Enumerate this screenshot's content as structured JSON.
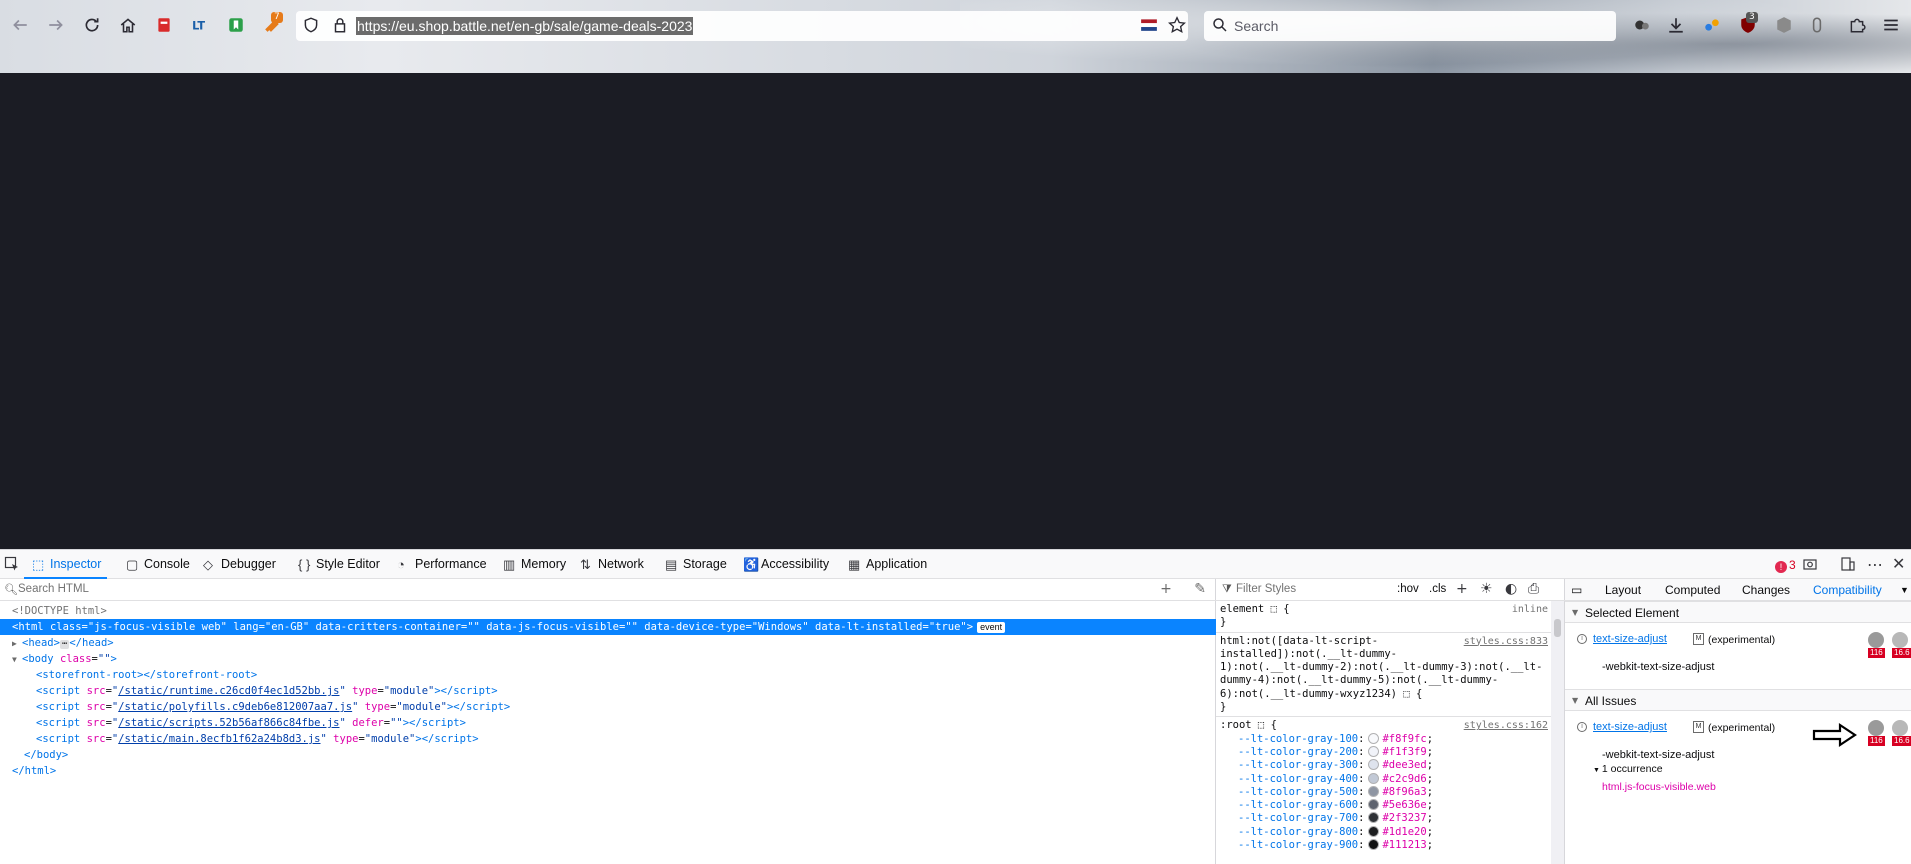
{
  "browser": {
    "url": "https://eu.shop.battle.net/en-gb/sale/game-deals-2023",
    "search_placeholder": "Search",
    "ext_badge_7": "7",
    "ext_badge_3": "3"
  },
  "devtools": {
    "tabs": [
      {
        "label": "Inspector",
        "icon": "inspector-icon"
      },
      {
        "label": "Console",
        "icon": "console-icon"
      },
      {
        "label": "Debugger",
        "icon": "debugger-icon"
      },
      {
        "label": "Style Editor",
        "icon": "style-editor-icon"
      },
      {
        "label": "Performance",
        "icon": "performance-icon"
      },
      {
        "label": "Memory",
        "icon": "memory-icon"
      },
      {
        "label": "Network",
        "icon": "network-icon"
      },
      {
        "label": "Storage",
        "icon": "storage-icon"
      },
      {
        "label": "Accessibility",
        "icon": "accessibility-icon"
      },
      {
        "label": "Application",
        "icon": "application-icon"
      }
    ],
    "error_count": "3",
    "markup": {
      "search_placeholder": "Search HTML",
      "doctype": "<!DOCTYPE html>",
      "html_open": {
        "tag": "html",
        "attrs": [
          {
            "name": "class",
            "value": "js-focus-visible web"
          },
          {
            "name": "lang",
            "value": "en-GB"
          },
          {
            "name": "data-critters-container",
            "value": ""
          },
          {
            "name": "data-js-focus-visible",
            "value": ""
          },
          {
            "name": "data-device-type",
            "value": "Windows"
          },
          {
            "name": "data-lt-installed",
            "value": "true"
          }
        ],
        "event_badge": "event"
      },
      "head_line": {
        "open": "<head>",
        "close": "</head>"
      },
      "body_open": {
        "tag": "body",
        "attr": "class",
        "value": ""
      },
      "storefront": "<storefront-root></storefront-root>",
      "scripts": [
        {
          "src": "/static/runtime.c26cd0f4ec1d52bb.js",
          "extra_attr": "type",
          "extra_val": "module"
        },
        {
          "src": "/static/polyfills.c9deb6e812007aa7.js",
          "extra_attr": "type",
          "extra_val": "module"
        },
        {
          "src": "/static/scripts.52b56af866c84fbe.js",
          "extra_attr": "defer",
          "extra_val": ""
        },
        {
          "src": "/static/main.8ecfb1f62a24b8d3.js",
          "extra_attr": "type",
          "extra_val": "module"
        }
      ],
      "body_close": "</body>",
      "html_close": "</html>"
    },
    "rules": {
      "filter_placeholder": "Filter Styles",
      "hov": ":hov",
      "cls": ".cls",
      "element_selector": "element ⬚ {",
      "inline": "inline",
      "close_brace": "}",
      "html_not_lines": [
        "html:not([data-lt-script-",
        "installed]):not(.__lt-dummy-",
        "1):not(.__lt-dummy-2):not(.__lt-dummy-3):not(.__lt-",
        "dummy-4):not(.__lt-dummy-5):not(.__lt-dummy-",
        "6):not(.__lt-dummy-wxyz1234) ⬚ {"
      ],
      "html_not_source": "styles.css:833",
      "root_selector": ":root ⬚ {",
      "root_source": "styles.css:162",
      "vars": [
        {
          "name": "--lt-color-gray-100",
          "value": "#f8f9fc",
          "swatch": "#f8f9fc"
        },
        {
          "name": "--lt-color-gray-200",
          "value": "#f1f3f9",
          "swatch": "#f1f3f9"
        },
        {
          "name": "--lt-color-gray-300",
          "value": "#dee3ed",
          "swatch": "#dee3ed"
        },
        {
          "name": "--lt-color-gray-400",
          "value": "#c2c9d6",
          "swatch": "#c2c9d6"
        },
        {
          "name": "--lt-color-gray-500",
          "value": "#8f96a3",
          "swatch": "#8f96a3"
        },
        {
          "name": "--lt-color-gray-600",
          "value": "#5e636e",
          "swatch": "#5e636e"
        },
        {
          "name": "--lt-color-gray-700",
          "value": "#2f3237",
          "swatch": "#2f3237"
        },
        {
          "name": "--lt-color-gray-800",
          "value": "#1d1e20",
          "swatch": "#1d1e20"
        },
        {
          "name": "--lt-color-gray-900",
          "value": "#111213",
          "swatch": "#111213"
        }
      ]
    },
    "compat": {
      "tabs": [
        "Layout",
        "Computed",
        "Changes",
        "Compatibility"
      ],
      "selected_header": "Selected Element",
      "all_header": "All Issues",
      "issue_prop": "text-size-adjust",
      "issue_mark": "M",
      "issue_experimental": "(experimental)",
      "issue_alias": "-webkit-text-size-adjust",
      "occurrence": "1 occurrence",
      "occurrence_node": "html.js-focus-visible.web",
      "browser_versions": [
        "116",
        "16.6"
      ]
    }
  }
}
